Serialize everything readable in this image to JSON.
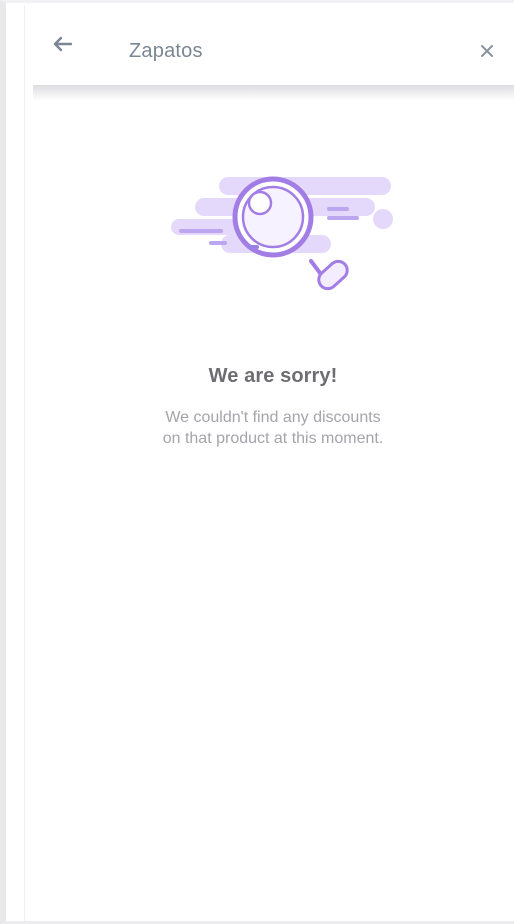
{
  "header": {
    "back_icon": "arrow-left-icon",
    "title": "Zapatos",
    "close_icon": "close-icon"
  },
  "empty_state": {
    "illustration": "magnifying-glass-icon",
    "title": "We are sorry!",
    "message_line_1": "We couldn't find any discounts",
    "message_line_2": "on that product at this moment."
  },
  "colors": {
    "accent": "#a37de6",
    "accent_light": "#e5d9fb",
    "title_text": "#6d6d72",
    "body_text": "#a4a4aa",
    "header_text": "#7b8694"
  }
}
